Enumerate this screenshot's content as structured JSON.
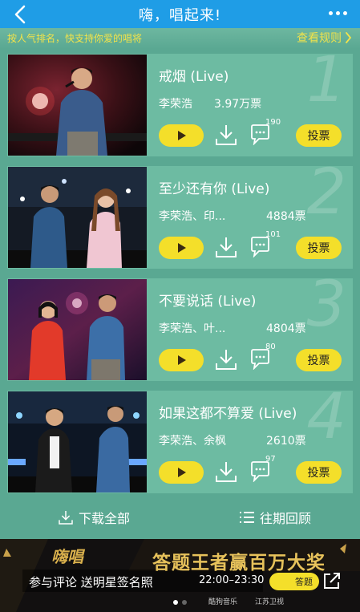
{
  "header": {
    "title": "嗨，唱起来!",
    "back_icon": "chevron-left-icon",
    "more_icon": "ellipsis-icon"
  },
  "subheader": {
    "hint": "按人气排名，快支持你爱的唱将",
    "rules_label": "查看规则"
  },
  "songs": [
    {
      "rank": "1",
      "title": "戒烟 (Live)",
      "artist": "李荣浩",
      "votes": "3.97万票",
      "comments": "190",
      "vote_label": "投票"
    },
    {
      "rank": "2",
      "title": "至少还有你 (Live)",
      "artist": "李荣浩、印...",
      "votes": "4884票",
      "comments": "101",
      "vote_label": "投票"
    },
    {
      "rank": "3",
      "title": "不要说话 (Live)",
      "artist": "李荣浩、叶...",
      "votes": "4804票",
      "comments": "80",
      "vote_label": "投票"
    },
    {
      "rank": "4",
      "title": "如果这都不算爱 (Live)",
      "artist": "李荣浩、余枫",
      "votes": "2610票",
      "comments": "97",
      "vote_label": "投票"
    }
  ],
  "actions": {
    "download_all": "下载全部",
    "history": "往期回顾"
  },
  "banner": {
    "logo": "嗨唱",
    "headline": "答题王者赢百万大奖",
    "comment_promo": "参与评论 送明星签名照",
    "time": "22:00–23:30",
    "answer_label": "答题",
    "brand_1": "酷狗音乐",
    "brand_2": "江苏卫视"
  },
  "colors": {
    "topbar": "#1f9de6",
    "background": "#5aa892",
    "card": "#6dbba2",
    "accent_yellow": "#f4df2a",
    "hint_yellow": "#f2e34a"
  }
}
